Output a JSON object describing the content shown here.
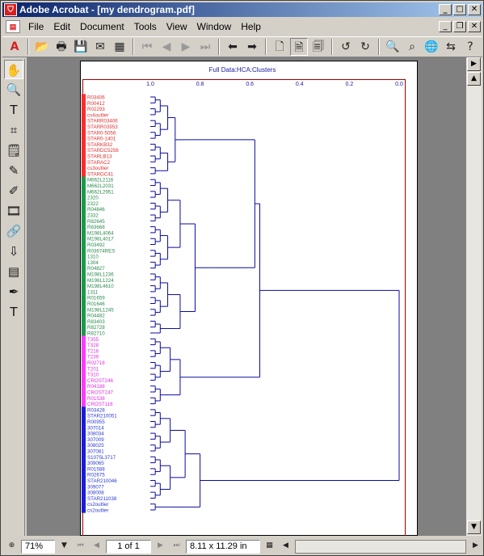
{
  "window": {
    "title": "Adobe Acrobat - [my dendrogram.pdf]"
  },
  "menu": [
    "File",
    "Edit",
    "Document",
    "Tools",
    "View",
    "Window",
    "Help"
  ],
  "status": {
    "zoom": "71%",
    "page": "1 of 1",
    "size": "8.11 x 11.29 in"
  },
  "chart_data": {
    "type": "dendrogram",
    "title": "Full Data:HCA:Clusters",
    "x_ticks": [
      "1.0",
      "0.8",
      "0.6",
      "0.4",
      "0.2",
      "0.0"
    ],
    "xlim": [
      1.0,
      0.0
    ],
    "groups": [
      {
        "color": "#ff2a2a",
        "text_color": "#e03030",
        "labels": [
          "R03406",
          "R00412",
          "R02293",
          "cs4outlier",
          "STARR03406",
          "STARR03953",
          "STAR0-5056",
          "STAR0-1401",
          "STARKB32",
          "STARDC5256",
          "STARLB13",
          "STARAC2",
          "cs3outlier",
          "STARGC41"
        ]
      },
      {
        "color": "#1a9a4a",
        "text_color": "#2a8a4a",
        "labels": [
          "M662L2116",
          "M662L2031",
          "M662L2951",
          "2320",
          "2322",
          "R04846",
          "2332",
          "R82645",
          "R83668",
          "M198L4064",
          "M198L4017",
          "R03492",
          "R03674RES",
          "1310",
          "1304",
          "R04827",
          "M198L1236",
          "M198L1224",
          "M198L4610",
          "1311",
          "R01659",
          "R01646",
          "M198L1245",
          "R04482",
          "R83403",
          "R82728",
          "R82710"
        ]
      },
      {
        "color": "#ff3aff",
        "text_color": "#e030e0",
        "labels": [
          "T355",
          "T328",
          "T216",
          "T239",
          "R02718",
          "T201",
          "T310",
          "CROST246",
          "R04188",
          "CROST247",
          "R01538",
          "CROST116"
        ]
      },
      {
        "color": "#1a1ae0",
        "text_color": "#2a3ad0",
        "labels": [
          "R03428",
          "STAR210051",
          "R00955",
          "307014",
          "308034",
          "307009",
          "308025",
          "307081",
          "S1075L3717",
          "309065",
          "R01588",
          "R02675",
          "STAR210046",
          "309077",
          "308008",
          "STAR211038",
          "cs2outlier",
          "cs2outlier"
        ]
      }
    ]
  }
}
